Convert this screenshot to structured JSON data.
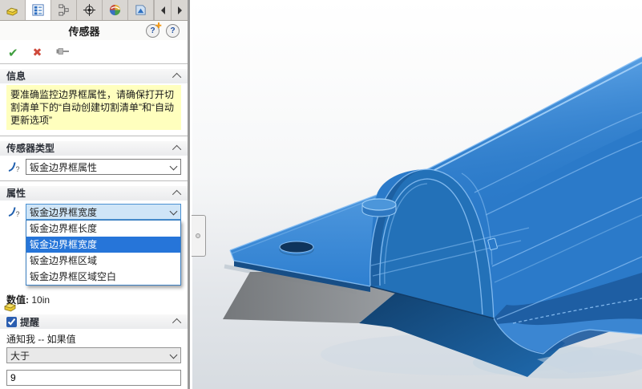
{
  "colors": {
    "accent": "#2675d9",
    "selection_bg": "#cfe5f7",
    "info_bg": "#ffffbe",
    "part_blue": "#2b7ac9",
    "edge_highlight": "#8cc1f4"
  },
  "icons": {
    "check_glyph": "✔",
    "cross_glyph": "✖",
    "question_glyph": "?",
    "tabs": [
      "part-icon",
      "property-manager-icon",
      "configuration-icon",
      "dimxpert-icon",
      "display-manager-icon",
      "cam-icon"
    ]
  },
  "header": {
    "title": "传感器"
  },
  "sections": {
    "info": {
      "title": "信息",
      "message": "要准确监控边界框属性，请确保打开切割清单下的“自动创建切割清单”和“自动更新选项”"
    },
    "sensor_type": {
      "title": "传感器类型",
      "value": "钣金边界框属性"
    },
    "properties": {
      "title": "属性",
      "value": "钣金边界框宽度",
      "selected_index": 1,
      "options": [
        "钣金边界框长度",
        "钣金边界框宽度",
        "钣金边界框区域",
        "钣金边界框区域空白"
      ]
    },
    "value": {
      "label": "数值:",
      "text": "10in"
    },
    "alert": {
      "title": "提醒",
      "checked": true,
      "prompt": "通知我 -- 如果值",
      "operator": "大于",
      "threshold": "9"
    }
  },
  "viewport": {
    "content": "sheet-metal-part-3d-view",
    "background_top": "#ffffff",
    "background_bottom": "#d7dce1"
  }
}
